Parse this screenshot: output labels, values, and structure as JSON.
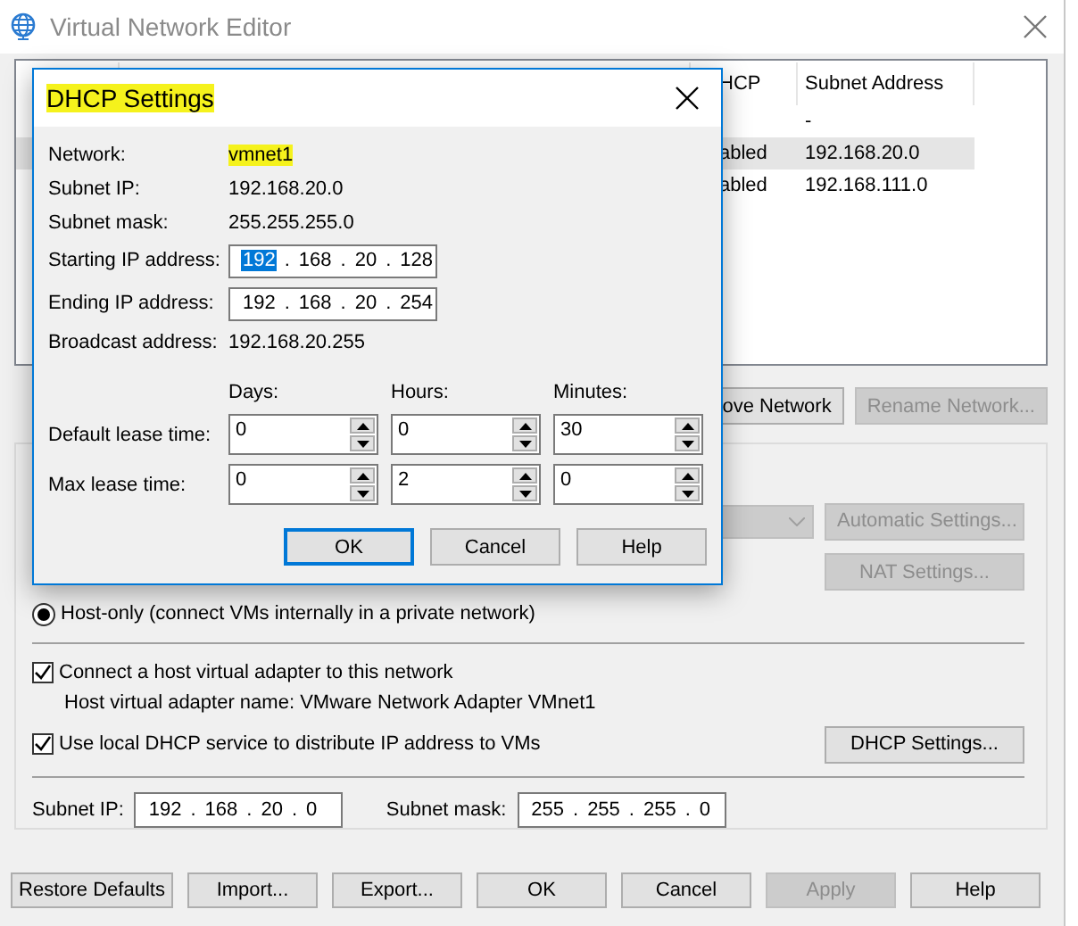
{
  "window": {
    "title": "Virtual Network Editor"
  },
  "network_table": {
    "columns": [
      "HCP",
      "Subnet Address"
    ],
    "rows": [
      {
        "col_3": "-",
        "selected": false
      },
      {
        "col_2": "abled",
        "col_3": "192.168.20.0",
        "selected": true
      },
      {
        "col_2": "abled",
        "col_3": "192.168.111.0",
        "selected": false
      }
    ]
  },
  "network_buttons": [
    {
      "label": "ove Network",
      "disabled": false
    },
    {
      "label": "Rename Network...",
      "disabled": true
    }
  ],
  "settings_group": {
    "connection_dropdown": {
      "disabled": true
    },
    "automatic_settings_button": {
      "label": "Automatic Settings...",
      "disabled": true
    },
    "nat_settings_button": {
      "label": "NAT Settings...",
      "disabled": true
    },
    "host_only_radio": {
      "label": "Host-only (connect VMs internally in a private network)",
      "selected": true
    },
    "connect_adapter_checkbox": {
      "label": "Connect a host virtual adapter to this network",
      "checked": true
    },
    "adapter_name": "Host virtual adapter name: VMware Network Adapter VMnet1",
    "dhcp_checkbox": {
      "label": "Use local DHCP service to distribute IP address to VMs",
      "checked": true
    },
    "dhcp_settings_button": {
      "label": "DHCP Settings...",
      "disabled": false
    },
    "subnet_ip": {
      "label": "Subnet IP:",
      "separator": ".",
      "octets": [
        {
          "text": "192",
          "selected": false
        },
        {
          "text": "168",
          "selected": false
        },
        {
          "text": "20",
          "selected": false
        },
        {
          "text": "0",
          "selected": false
        }
      ]
    },
    "subnet_mask": {
      "label": "Subnet mask:",
      "separator": ".",
      "octets": [
        {
          "text": "255",
          "selected": false
        },
        {
          "text": "255",
          "selected": false
        },
        {
          "text": "255",
          "selected": false
        },
        {
          "text": "0",
          "selected": false
        }
      ]
    }
  },
  "bottom_buttons": [
    {
      "label": "Restore Defaults",
      "disabled": false
    },
    {
      "label": "Import...",
      "disabled": false
    },
    {
      "label": "Export...",
      "disabled": false
    },
    {
      "label": "OK",
      "disabled": false
    },
    {
      "label": "Cancel",
      "disabled": false
    },
    {
      "label": "Apply",
      "disabled": true
    },
    {
      "label": "Help",
      "disabled": false
    }
  ],
  "dhcp_dialog": {
    "title": "DHCP Settings",
    "title_highlighted": true,
    "info": [
      {
        "label": "Network:",
        "value": "vmnet1",
        "highlighted": true
      },
      {
        "label": "Subnet IP:",
        "value": "192.168.20.0",
        "highlighted": false
      },
      {
        "label": "Subnet mask:",
        "value": "255.255.255.0",
        "highlighted": false
      }
    ],
    "ip_fields": [
      {
        "label": "Starting IP address:",
        "separator": ".",
        "octets": [
          {
            "text": "192",
            "selected": true
          },
          {
            "text": "168",
            "selected": false
          },
          {
            "text": "20",
            "selected": false
          },
          {
            "text": "128",
            "selected": false
          }
        ]
      },
      {
        "label": "Ending IP address:",
        "separator": ".",
        "octets": [
          {
            "text": "192",
            "selected": false
          },
          {
            "text": "168",
            "selected": false
          },
          {
            "text": "20",
            "selected": false
          },
          {
            "text": "254",
            "selected": false
          }
        ]
      }
    ],
    "broadcast": {
      "label": "Broadcast address:",
      "value": "192.168.20.255"
    },
    "lease_headers": [
      "Days:",
      "Hours:",
      "Minutes:"
    ],
    "lease_rows": [
      {
        "label": "Default lease time:",
        "values": [
          "0",
          "0",
          "30"
        ]
      },
      {
        "label": "Max lease time:",
        "values": [
          "0",
          "2",
          "0"
        ]
      }
    ],
    "buttons": [
      {
        "label": "OK",
        "default": true
      },
      {
        "label": "Cancel",
        "default": false
      },
      {
        "label": "Help",
        "default": false
      }
    ]
  }
}
